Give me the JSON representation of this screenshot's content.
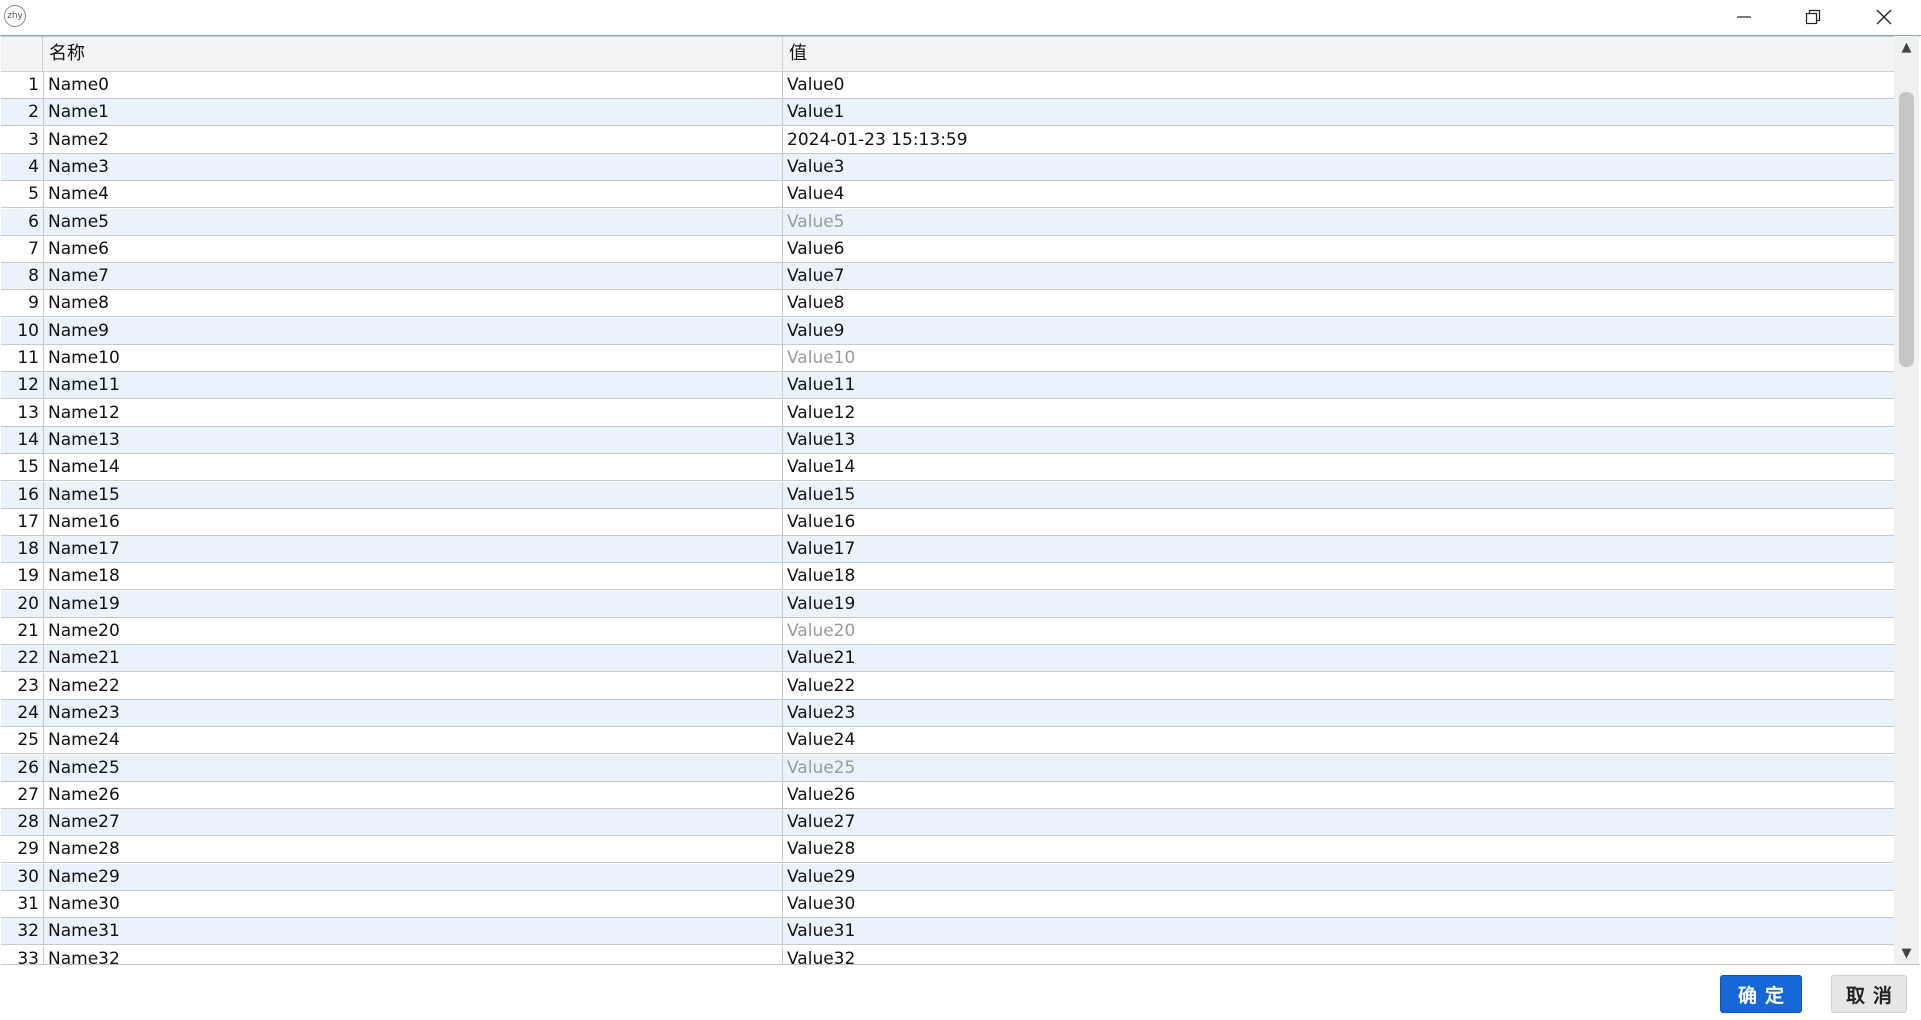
{
  "window": {
    "app_icon_text": "zhy",
    "minimize_icon": "minimize-icon",
    "restore_icon": "restore-icon",
    "close_icon": "close-icon"
  },
  "grid": {
    "columns": [
      "名称",
      "值"
    ],
    "rows": [
      {
        "num": "1",
        "name": "Name0",
        "value": "Value0",
        "dim": false
      },
      {
        "num": "2",
        "name": "Name1",
        "value": "Value1",
        "dim": false
      },
      {
        "num": "3",
        "name": "Name2",
        "value": "2024-01-23 15:13:59",
        "dim": false
      },
      {
        "num": "4",
        "name": "Name3",
        "value": "Value3",
        "dim": false
      },
      {
        "num": "5",
        "name": "Name4",
        "value": "Value4",
        "dim": false
      },
      {
        "num": "6",
        "name": "Name5",
        "value": "Value5",
        "dim": true
      },
      {
        "num": "7",
        "name": "Name6",
        "value": "Value6",
        "dim": false
      },
      {
        "num": "8",
        "name": "Name7",
        "value": "Value7",
        "dim": false
      },
      {
        "num": "9",
        "name": "Name8",
        "value": "Value8",
        "dim": false
      },
      {
        "num": "10",
        "name": "Name9",
        "value": "Value9",
        "dim": false
      },
      {
        "num": "11",
        "name": "Name10",
        "value": "Value10",
        "dim": true
      },
      {
        "num": "12",
        "name": "Name11",
        "value": "Value11",
        "dim": false
      },
      {
        "num": "13",
        "name": "Name12",
        "value": "Value12",
        "dim": false
      },
      {
        "num": "14",
        "name": "Name13",
        "value": "Value13",
        "dim": false
      },
      {
        "num": "15",
        "name": "Name14",
        "value": "Value14",
        "dim": false
      },
      {
        "num": "16",
        "name": "Name15",
        "value": "Value15",
        "dim": false
      },
      {
        "num": "17",
        "name": "Name16",
        "value": "Value16",
        "dim": false
      },
      {
        "num": "18",
        "name": "Name17",
        "value": "Value17",
        "dim": false
      },
      {
        "num": "19",
        "name": "Name18",
        "value": "Value18",
        "dim": false
      },
      {
        "num": "20",
        "name": "Name19",
        "value": "Value19",
        "dim": false
      },
      {
        "num": "21",
        "name": "Name20",
        "value": "Value20",
        "dim": true
      },
      {
        "num": "22",
        "name": "Name21",
        "value": "Value21",
        "dim": false
      },
      {
        "num": "23",
        "name": "Name22",
        "value": "Value22",
        "dim": false
      },
      {
        "num": "24",
        "name": "Name23",
        "value": "Value23",
        "dim": false
      },
      {
        "num": "25",
        "name": "Name24",
        "value": "Value24",
        "dim": false
      },
      {
        "num": "26",
        "name": "Name25",
        "value": "Value25",
        "dim": true
      },
      {
        "num": "27",
        "name": "Name26",
        "value": "Value26",
        "dim": false
      },
      {
        "num": "28",
        "name": "Name27",
        "value": "Value27",
        "dim": false
      },
      {
        "num": "29",
        "name": "Name28",
        "value": "Value28",
        "dim": false
      },
      {
        "num": "30",
        "name": "Name29",
        "value": "Value29",
        "dim": false
      },
      {
        "num": "31",
        "name": "Name30",
        "value": "Value30",
        "dim": false
      },
      {
        "num": "32",
        "name": "Name31",
        "value": "Value31",
        "dim": false
      },
      {
        "num": "33",
        "name": "Name32",
        "value": "Value32",
        "dim": false
      }
    ]
  },
  "scrollbar": {
    "up_icon": "▲",
    "down_icon": "▼"
  },
  "footer": {
    "ok_label": "确定",
    "cancel_label": "取消"
  },
  "colors": {
    "accent": "#1668d8",
    "alt_row": "#eaf3fb",
    "dim_text": "#9a9a9a"
  }
}
